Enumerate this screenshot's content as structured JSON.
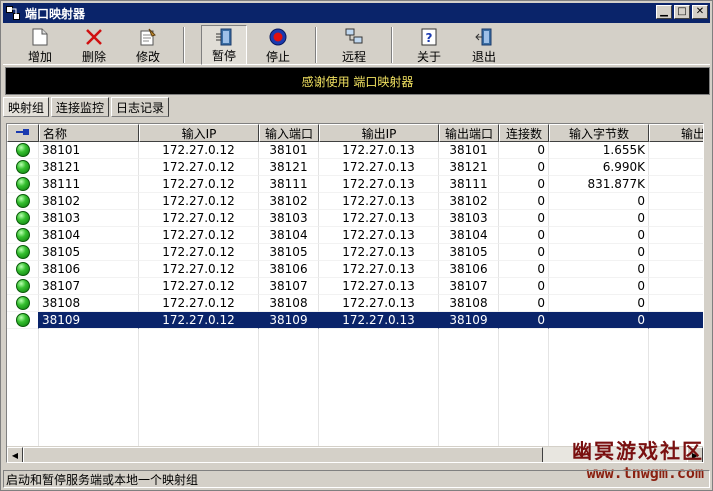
{
  "window": {
    "title": "端口映射器"
  },
  "toolbar": {
    "buttons": [
      {
        "id": "add",
        "label": "增加",
        "icon": "new-document-icon"
      },
      {
        "id": "delete",
        "label": "删除",
        "icon": "delete-x-icon"
      },
      {
        "id": "modify",
        "label": "修改",
        "icon": "edit-document-icon"
      },
      {
        "id": "pause",
        "label": "暂停",
        "icon": "pause-door-icon"
      },
      {
        "id": "stop",
        "label": "停止",
        "icon": "stop-icon"
      },
      {
        "id": "remote",
        "label": "远程",
        "icon": "remote-computer-icon"
      },
      {
        "id": "about",
        "label": "关于",
        "icon": "help-icon"
      },
      {
        "id": "exit",
        "label": "退出",
        "icon": "exit-door-icon"
      }
    ]
  },
  "banner": {
    "text": "感谢使用 端口映射器"
  },
  "tabs": [
    {
      "label": "映射组",
      "active": true
    },
    {
      "label": "连接监控",
      "active": false
    },
    {
      "label": "日志记录",
      "active": false
    }
  ],
  "table": {
    "columns": [
      "名称",
      "输入IP",
      "输入端口",
      "输出IP",
      "输出端口",
      "连接数",
      "输入字节数",
      "输出"
    ],
    "rows": [
      {
        "name": "38101",
        "in_ip": "172.27.0.12",
        "in_port": "38101",
        "out_ip": "172.27.0.13",
        "out_port": "38101",
        "conn": "0",
        "in_bytes": "1.655K",
        "selected": false
      },
      {
        "name": "38121",
        "in_ip": "172.27.0.12",
        "in_port": "38121",
        "out_ip": "172.27.0.13",
        "out_port": "38121",
        "conn": "0",
        "in_bytes": "6.990K",
        "selected": false
      },
      {
        "name": "38111",
        "in_ip": "172.27.0.12",
        "in_port": "38111",
        "out_ip": "172.27.0.13",
        "out_port": "38111",
        "conn": "0",
        "in_bytes": "831.877K",
        "selected": false
      },
      {
        "name": "38102",
        "in_ip": "172.27.0.12",
        "in_port": "38102",
        "out_ip": "172.27.0.13",
        "out_port": "38102",
        "conn": "0",
        "in_bytes": "0",
        "selected": false
      },
      {
        "name": "38103",
        "in_ip": "172.27.0.12",
        "in_port": "38103",
        "out_ip": "172.27.0.13",
        "out_port": "38103",
        "conn": "0",
        "in_bytes": "0",
        "selected": false
      },
      {
        "name": "38104",
        "in_ip": "172.27.0.12",
        "in_port": "38104",
        "out_ip": "172.27.0.13",
        "out_port": "38104",
        "conn": "0",
        "in_bytes": "0",
        "selected": false
      },
      {
        "name": "38105",
        "in_ip": "172.27.0.12",
        "in_port": "38105",
        "out_ip": "172.27.0.13",
        "out_port": "38105",
        "conn": "0",
        "in_bytes": "0",
        "selected": false
      },
      {
        "name": "38106",
        "in_ip": "172.27.0.12",
        "in_port": "38106",
        "out_ip": "172.27.0.13",
        "out_port": "38106",
        "conn": "0",
        "in_bytes": "0",
        "selected": false
      },
      {
        "name": "38107",
        "in_ip": "172.27.0.12",
        "in_port": "38107",
        "out_ip": "172.27.0.13",
        "out_port": "38107",
        "conn": "0",
        "in_bytes": "0",
        "selected": false
      },
      {
        "name": "38108",
        "in_ip": "172.27.0.12",
        "in_port": "38108",
        "out_ip": "172.27.0.13",
        "out_port": "38108",
        "conn": "0",
        "in_bytes": "0",
        "selected": false
      },
      {
        "name": "38109",
        "in_ip": "172.27.0.12",
        "in_port": "38109",
        "out_ip": "172.27.0.13",
        "out_port": "38109",
        "conn": "0",
        "in_bytes": "0",
        "selected": true
      }
    ]
  },
  "watermark": {
    "title": "幽冥游戏社区",
    "url": "www.tnwgm.com"
  },
  "statusbar": {
    "text": "启动和暂停服务端或本地一个映射组"
  },
  "colors": {
    "selection": "#0a246a",
    "banner_text": "#f0e060",
    "titlebar": "#0a246a"
  }
}
